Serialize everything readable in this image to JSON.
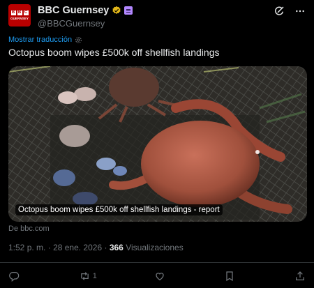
{
  "account": {
    "display_name": "BBC Guernsey",
    "handle": "@BBCGuernsey",
    "avatar_letters": [
      "B",
      "B",
      "C"
    ],
    "avatar_subtitle": "GUERNSEY",
    "verified_icon": "verified-badge-icon",
    "affiliation_icon": "government-affiliation-icon"
  },
  "header_actions": [
    "grok-icon",
    "more-icon"
  ],
  "translate": {
    "label": "Mostrar traducción",
    "icon": "gear-icon"
  },
  "tweet": {
    "text": "Octopus boom wipes £500k off shellfish landings"
  },
  "card": {
    "caption": "Octopus boom wipes £500k off shellfish landings - report",
    "source": "De bbc.com"
  },
  "meta": {
    "time": "1:52 p. m.",
    "separator": "·",
    "date": "28 ene. 2026",
    "views_count": "366",
    "views_label": "Visualizaciones"
  },
  "actions": {
    "reply_count": "",
    "repost_count": "1",
    "like_count": "",
    "bookmark_count": ""
  },
  "colors": {
    "background": "#000000",
    "text": "#e7e9ea",
    "muted": "#71767b",
    "link": "#1d9bf0",
    "avatar": "#b80000",
    "verified": "#e2b719",
    "divider": "#2f3336"
  }
}
